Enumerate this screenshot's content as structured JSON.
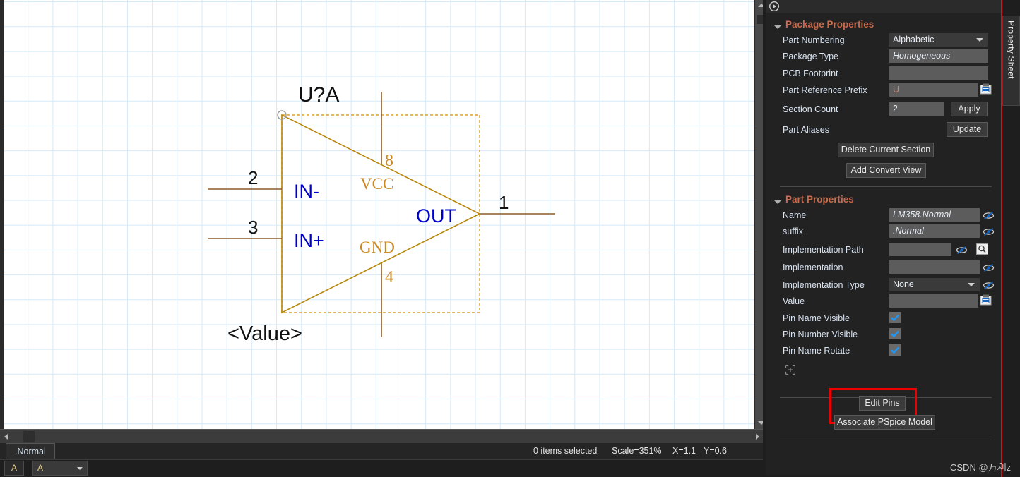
{
  "canvas": {
    "part_label": "U?A",
    "value_label": "<Value>",
    "pins": [
      {
        "number": "2",
        "name": "IN-"
      },
      {
        "number": "3",
        "name": "IN+"
      },
      {
        "number": "1",
        "name": "OUT"
      },
      {
        "number": "8",
        "name": "VCC"
      },
      {
        "number": "4",
        "name": "GND"
      }
    ],
    "colors": {
      "grid": "#d6e9f7",
      "symbol_outline": "#b8860b",
      "pin_wire": "#8b5a2b",
      "pin_name": "#0000cc",
      "pin_number_black": "#000000",
      "pin_number_orange": "#cc8822"
    }
  },
  "status_bar": {
    "tab_label": ".Normal",
    "items_selected": "0 items selected",
    "scale": "Scale=351%",
    "x": "X=1.1",
    "y": "Y=0.6"
  },
  "font_bar": {
    "button_label": "A",
    "select_value": "A"
  },
  "panel": {
    "vertical_tab": "Property Sheet",
    "package_properties": {
      "title": "Package Properties",
      "rows": [
        {
          "label": "Part Numbering",
          "value": "Alphabetic",
          "kind": "dropdown"
        },
        {
          "label": "Package Type",
          "value": "Homogeneous",
          "kind": "italic-readonly"
        },
        {
          "label": "PCB Footprint",
          "value": "",
          "kind": "text"
        },
        {
          "label": "Part Reference Prefix",
          "value": "U",
          "kind": "text-icon"
        },
        {
          "label": "Section Count",
          "value": "2",
          "kind": "text-short"
        },
        {
          "label": "Part Aliases",
          "value": "",
          "kind": "none"
        }
      ],
      "apply_label": "Apply",
      "update_label": "Update",
      "delete_section_label": "Delete Current Section",
      "add_convert_label": "Add Convert View"
    },
    "part_properties": {
      "title": "Part Properties",
      "rows": [
        {
          "label": "Name",
          "value": "LM358.Normal",
          "kind": "italic-readonly-eye"
        },
        {
          "label": "suffix",
          "value": ".Normal",
          "kind": "italic-readonly-eye"
        },
        {
          "label": "Implementation Path",
          "value": "",
          "kind": "text-eye-browse"
        },
        {
          "label": "Implementation",
          "value": "",
          "kind": "text-eye"
        },
        {
          "label": "Implementation Type",
          "value": "None",
          "kind": "dropdown-eye"
        },
        {
          "label": "Value",
          "value": "",
          "kind": "text-icon"
        },
        {
          "label": "Pin Name Visible",
          "value": "",
          "kind": "checkbox",
          "checked": true
        },
        {
          "label": "Pin Number Visible",
          "value": "",
          "kind": "checkbox",
          "checked": true
        },
        {
          "label": "Pin Name Rotate",
          "value": "",
          "kind": "checkbox",
          "checked": true
        }
      ],
      "edit_pins_label": "Edit Pins",
      "associate_pspice_label": "Associate PSpice Model"
    },
    "accent_color": "#c96a4a",
    "highlight_color": "#ee0000"
  },
  "watermark": "CSDN @万利z"
}
